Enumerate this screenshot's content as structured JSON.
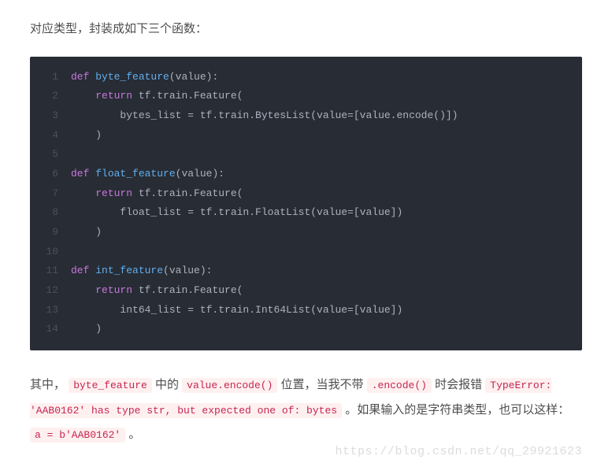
{
  "intro": "对应类型，封装成如下三个函数：",
  "code": {
    "lines": [
      {
        "n": "1",
        "html": "<span class='kw'>def</span> <span class='fn'>byte_feature</span>(value):"
      },
      {
        "n": "2",
        "html": "    <span class='kw'>return</span> tf.train.Feature("
      },
      {
        "n": "3",
        "html": "        bytes_list = tf.train.BytesList(value=[value.encode()])"
      },
      {
        "n": "4",
        "html": "    )"
      },
      {
        "n": "5",
        "html": ""
      },
      {
        "n": "6",
        "html": "<span class='kw'>def</span> <span class='fn'>float_feature</span>(value):"
      },
      {
        "n": "7",
        "html": "    <span class='kw'>return</span> tf.train.Feature("
      },
      {
        "n": "8",
        "html": "        float_list = tf.train.FloatList(value=[value])"
      },
      {
        "n": "9",
        "html": "    )"
      },
      {
        "n": "10",
        "html": ""
      },
      {
        "n": "11",
        "html": "<span class='kw'>def</span> <span class='fn'>int_feature</span>(value):"
      },
      {
        "n": "12",
        "html": "    <span class='kw'>return</span> tf.train.Feature("
      },
      {
        "n": "13",
        "html": "        int64_list = tf.train.Int64List(value=[value])"
      },
      {
        "n": "14",
        "html": "    )"
      }
    ]
  },
  "explain": {
    "pre1": "其中，",
    "code1": "byte_feature",
    "mid1": " 中的 ",
    "code2": "value.encode()",
    "mid2": " 位置，当我不带 ",
    "code3": ".encode()",
    "mid3": " 时会报错 ",
    "code4": "TypeError: 'AAB0162' has type str, but expected one of: bytes",
    "mid4": " 。如果输入的是字符串类型，也可以这样：",
    "code5": "a = b'AAB0162'",
    "end": " 。"
  },
  "watermark": "https://blog.csdn.net/qq_29921623"
}
